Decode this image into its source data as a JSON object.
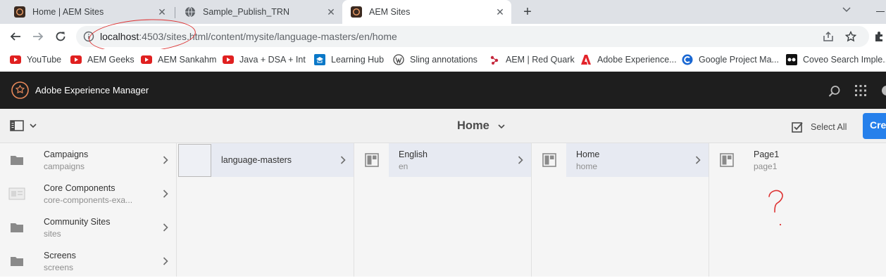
{
  "browser": {
    "tabs": [
      {
        "title": "Home | AEM Sites",
        "favicon": "aem-icon"
      },
      {
        "title": "Sample_Publish_TRN",
        "favicon": "globe-icon"
      },
      {
        "title": "AEM Sites",
        "favicon": "aem-icon",
        "active": true
      }
    ],
    "url_host": "localhost",
    "url_rest": ":4503/sites.html/content/mysite/language-masters/en/home"
  },
  "bookmarks": [
    {
      "label": "YouTube",
      "icon": "youtube-icon"
    },
    {
      "label": "AEM Geeks",
      "icon": "youtube-icon"
    },
    {
      "label": "AEM Sankahm",
      "icon": "youtube-icon"
    },
    {
      "label": "Java + DSA + Int",
      "icon": "youtube-icon"
    },
    {
      "label": "Learning Hub",
      "icon": "learning-hub-icon"
    },
    {
      "label": "Sling annotations",
      "icon": "wordpress-icon"
    },
    {
      "label": "AEM | Red Quark",
      "icon": "red-quark-icon"
    },
    {
      "label": "Adobe Experience...",
      "icon": "adobe-icon"
    },
    {
      "label": "Google Project Ma...",
      "icon": "c-logo-icon"
    },
    {
      "label": "Coveo Search Imple...",
      "icon": "coveo-icon"
    }
  ],
  "aem": {
    "title": "Adobe Experience Manager",
    "page_title": "Home",
    "select_all": "Select All",
    "create": "Cre"
  },
  "columns": [
    {
      "items": [
        {
          "title": "Campaigns",
          "name": "campaigns"
        },
        {
          "title": "Core Components",
          "name": "core-components-exa..."
        },
        {
          "title": "Community Sites",
          "name": "sites"
        },
        {
          "title": "Screens",
          "name": "screens"
        }
      ]
    },
    {
      "items": [
        {
          "title": "language-masters",
          "name": ""
        }
      ]
    },
    {
      "items": [
        {
          "title": "English",
          "name": "en"
        }
      ]
    },
    {
      "items": [
        {
          "title": "Home",
          "name": "home"
        }
      ]
    },
    {
      "items": [
        {
          "title": "Page1",
          "name": "page1"
        }
      ]
    }
  ],
  "colors": {
    "accent": "#2680eb",
    "header": "#1e1e1e",
    "annotation": "#dd3333"
  }
}
